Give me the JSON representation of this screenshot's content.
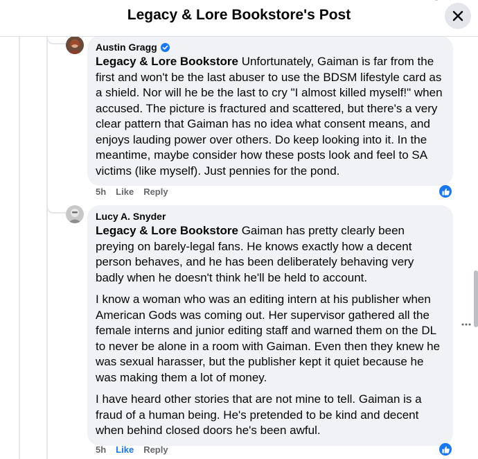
{
  "header": {
    "title": "Legacy & Lore Bookstore's Post"
  },
  "comments": [
    {
      "author": "Austin Gragg",
      "verified": true,
      "tag": "Legacy & Lore Bookstore",
      "text": "Unfortunately, Gaiman is far from the first and won't be the last abuser to use the BDSM lifestyle card as a shield. Nor will he be the last to cry \"I almost killed myself!\" when accused. The picture is fractured and scattered, but there's a very clear pattern that Gaiman has no idea what consent means, and enjoys lauding power over others. Do keep looking into it. In the meantime, maybe consider how these posts look and feel to SA victims (like myself). Just pennies for the pond.",
      "time": "5h",
      "like_label": "Like",
      "reply_label": "Reply",
      "reaction_icon": "thumbs-up-icon"
    },
    {
      "author": "Lucy A. Snyder",
      "verified": false,
      "tag": "Legacy & Lore Bookstore",
      "text": "Gaiman has pretty clearly been preying on barely-legal fans. He knows exactly how a decent person behaves, and he has been deliberately behaving very badly when he doesn't think he'll be held to account.",
      "paragraphs": [
        "I know a woman who was an editing intern at his publisher when American Gods was coming out. Her supervisor gathered all the female interns and junior editing staff and warned them on the DL to never be alone in a room with Gaiman. Even then they knew he was sexual harasser, but the publisher kept it quiet because he was making them a lot of money.",
        "I have heard other stories that are not mine to tell. Gaiman is a fraud of a human being. He's pretended to be kind and decent when behind closed doors he's been awful."
      ],
      "time": "5h",
      "like_label": "Like",
      "reply_label": "Reply",
      "reaction_icon": "thumbs-up-icon"
    }
  ],
  "more_icon": "more-dots-icon",
  "colors": {
    "accent": "#1877f2",
    "bubble": "#f0f2f5",
    "muted": "#65676b"
  }
}
